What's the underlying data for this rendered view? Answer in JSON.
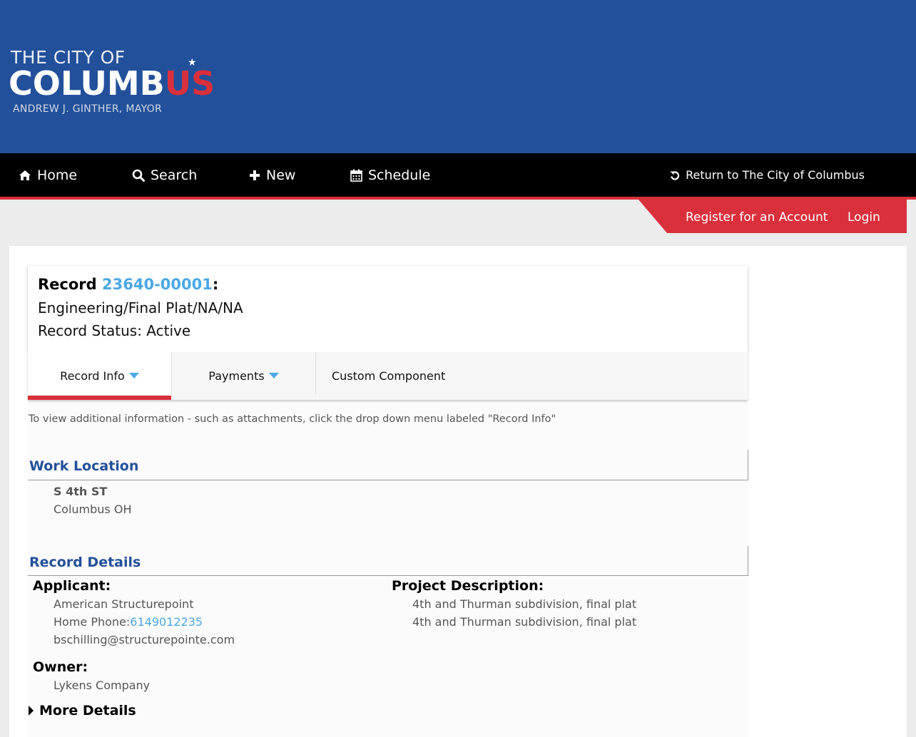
{
  "header": {
    "logo_line1": "THE CITY OF",
    "logo_line2_main": "COLUMB",
    "logo_line2_accent": "US",
    "logo_line3": "ANDREW J. GINTHER, MAYOR",
    "bg_color": "#23509a",
    "accent_color": "#d9303c"
  },
  "nav": {
    "items": [
      {
        "label": "Home",
        "icon": "home-icon"
      },
      {
        "label": "Search",
        "icon": "search-icon"
      },
      {
        "label": "New",
        "icon": "plus-icon"
      },
      {
        "label": "Schedule",
        "icon": "calendar-icon"
      }
    ],
    "return_label": "Return to The City of Columbus",
    "return_icon": "undo-icon"
  },
  "account": {
    "register_label": "Register for an Account",
    "login_label": "Login"
  },
  "record": {
    "prefix": "Record",
    "number": "23640-00001",
    "suffix": ":",
    "type": "Engineering/Final Plat/NA/NA",
    "status": "Record Status: Active"
  },
  "tabs": [
    {
      "label": "Record Info",
      "active": true,
      "has_dropdown": true
    },
    {
      "label": "Payments",
      "active": false,
      "has_dropdown": true
    },
    {
      "label": "Custom Component",
      "active": false,
      "has_dropdown": false
    }
  ],
  "hint": "To view additional information - such as attachments, click the drop down menu labeled \"Record Info\"",
  "work_location": {
    "title": "Work Location",
    "street": "S 4th ST",
    "city": "Columbus OH"
  },
  "record_details": {
    "title": "Record Details",
    "applicant": {
      "label": "Applicant:",
      "name": "American Structurepoint",
      "phone_label": "Home Phone:",
      "phone": "6149012235",
      "email": "bschilling@structurepointe.com"
    },
    "project_description": {
      "label": "Project Description:",
      "lines": [
        "4th and Thurman subdivision, final plat",
        "4th and Thurman subdivision, final plat"
      ]
    },
    "owner": {
      "label": "Owner:",
      "name": "Lykens Company"
    },
    "more_details": "More Details"
  }
}
